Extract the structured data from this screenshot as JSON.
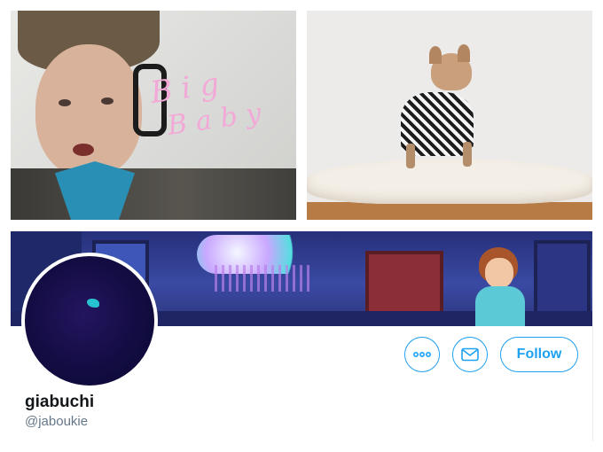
{
  "photos": {
    "boy": {
      "overlay_line1": "Big",
      "overlay_line2": "Baby"
    },
    "dog": {}
  },
  "profile": {
    "display_name": "giabuchi",
    "handle": "@jaboukie",
    "avatar": "avatar"
  },
  "actions": {
    "more_icon": "ellipsis-icon",
    "message_icon": "envelope-icon",
    "follow_label": "Follow"
  },
  "colors": {
    "accent": "#1da1f2",
    "name_text": "#14171a",
    "handle_text": "#657786"
  }
}
